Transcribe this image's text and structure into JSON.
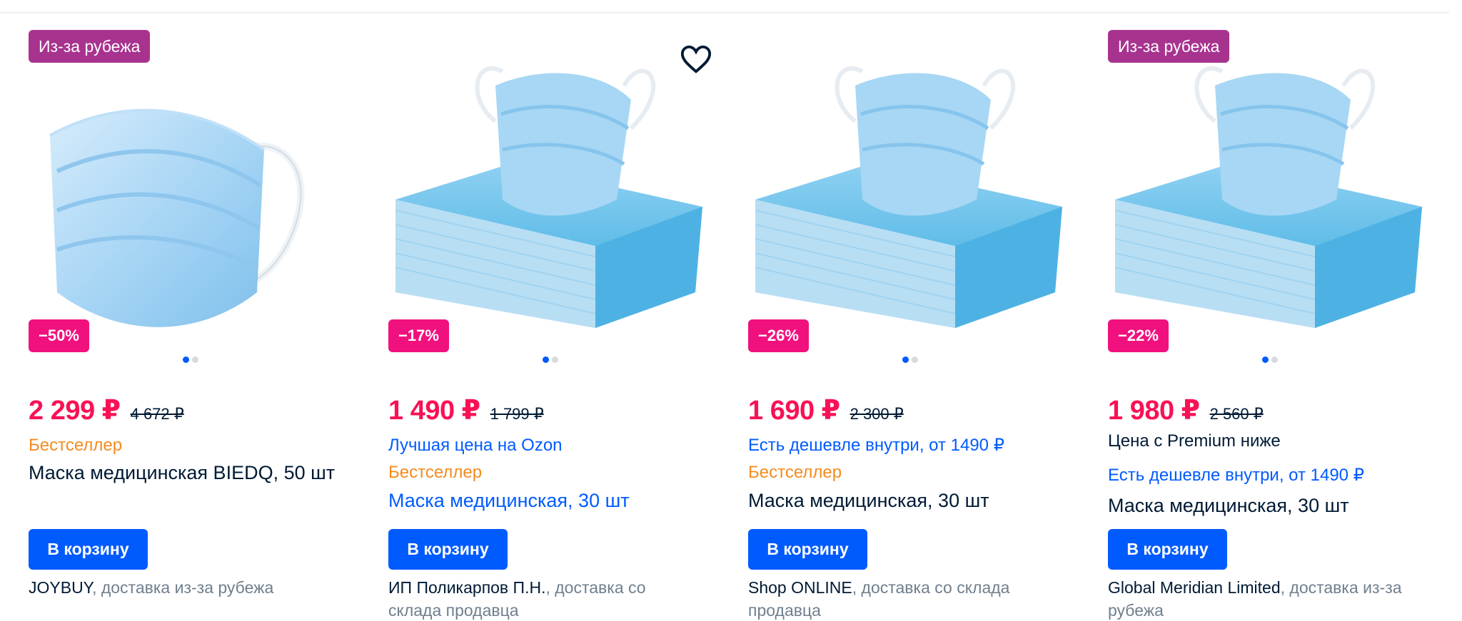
{
  "colors": {
    "price": "#f91155",
    "discount_badge": "#f1117e",
    "abroad_badge": "#a8338f",
    "bestseller": "#f68b1e",
    "link_blue": "#005bff",
    "button": "#005bff",
    "text": "#001a34",
    "muted": "#707f8d"
  },
  "products": [
    {
      "badge": "Из-за рубежа",
      "discount": "−50%",
      "price": "2 299 ₽",
      "old_price": "4 672 ₽",
      "bestseller": "Бестселлер",
      "title": "Маска медицинская BIEDQ, 50 шт",
      "cart": "В корзину",
      "seller": "JOYBUY",
      "delivery": ", доставка из-за рубежа",
      "image": "single-mask-image",
      "dots": {
        "count": 2,
        "active": 1
      }
    },
    {
      "discount": "−17%",
      "price": "1 490 ₽",
      "old_price": "1 799 ₽",
      "promo": "Лучшая цена на Ozon",
      "bestseller": "Бестселлер",
      "title": "Маска медицинская, 30 шт",
      "cart": "В корзину",
      "seller": "ИП Поликарпов П.Н.",
      "delivery": ", доставка со склада продавца",
      "favorite_icon": "heart-icon",
      "image": "mask-pack-image",
      "dots": {
        "count": 2,
        "active": 1
      }
    },
    {
      "discount": "−26%",
      "price": "1 690 ₽",
      "old_price": "2 300 ₽",
      "promo": "Есть дешевле внутри, от 1490 ₽",
      "bestseller": "Бестселлер",
      "title": "Маска медицинская, 30 шт",
      "cart": "В корзину",
      "seller": "Shop ONLINE",
      "delivery": ", доставка со склада продавца",
      "image": "mask-pack-image",
      "dots": {
        "count": 2,
        "active": 1
      }
    },
    {
      "badge": "Из-за рубежа",
      "discount": "−22%",
      "price": "1 980 ₽",
      "old_price": "2 560 ₽",
      "premium": "Цена с Premium ниже",
      "promo": "Есть дешевле внутри, от 1490 ₽",
      "title": "Маска медицинская, 30 шт",
      "cart": "В корзину",
      "seller": "Global Meridian Limited",
      "delivery": ", доставка из-за рубежа",
      "image": "mask-pack-image",
      "dots": {
        "count": 2,
        "active": 1
      }
    }
  ]
}
